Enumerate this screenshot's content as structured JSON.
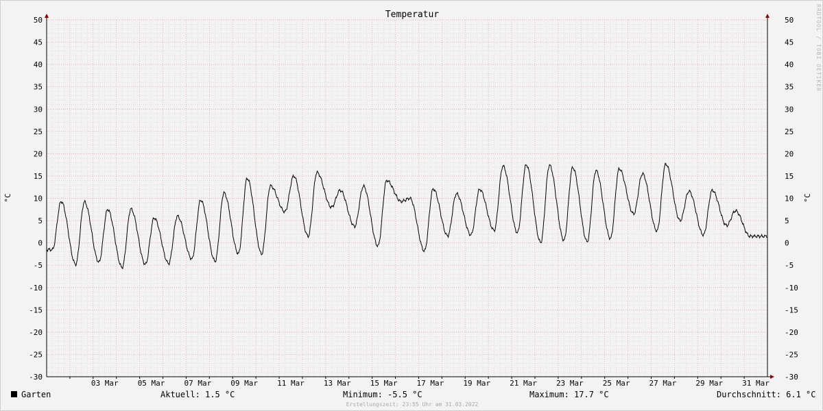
{
  "chart_data": {
    "type": "line",
    "title": "Temperatur",
    "ylabel": "°C",
    "ylim": [
      -30,
      50
    ],
    "y_ticks": [
      50,
      45,
      40,
      35,
      30,
      25,
      20,
      15,
      10,
      5,
      0,
      -5,
      -10,
      -15,
      -20,
      -25,
      -30
    ],
    "x_range": [
      "2022-03-01T00:00",
      "2022-04-01T00:00"
    ],
    "x_ticks": [
      "03 Mar",
      "05 Mar",
      "07 Mar",
      "09 Mar",
      "11 Mar",
      "13 Mar",
      "15 Mar",
      "17 Mar",
      "19 Mar",
      "21 Mar",
      "23 Mar",
      "25 Mar",
      "27 Mar",
      "29 Mar",
      "31 Mar"
    ],
    "grid": true,
    "series": [
      {
        "name": "Garten",
        "color": "#000000",
        "daily": [
          {
            "date": "2022-03-01",
            "min": -1.5,
            "max": 9.3
          },
          {
            "date": "2022-03-02",
            "min": -4.8,
            "max": 9.2
          },
          {
            "date": "2022-03-03",
            "min": -4.3,
            "max": 7.5
          },
          {
            "date": "2022-03-04",
            "min": -5.5,
            "max": 7.6
          },
          {
            "date": "2022-03-05",
            "min": -4.8,
            "max": 5.6
          },
          {
            "date": "2022-03-06",
            "min": -4.6,
            "max": 6.0
          },
          {
            "date": "2022-03-07",
            "min": -3.6,
            "max": 9.6
          },
          {
            "date": "2022-03-08",
            "min": -4.1,
            "max": 11.2
          },
          {
            "date": "2022-03-09",
            "min": -2.4,
            "max": 14.5
          },
          {
            "date": "2022-03-10",
            "min": -2.5,
            "max": 12.8
          },
          {
            "date": "2022-03-11",
            "min": 7.0,
            "max": 15.0
          },
          {
            "date": "2022-03-12",
            "min": 1.5,
            "max": 15.8
          },
          {
            "date": "2022-03-13",
            "min": 8.0,
            "max": 11.8
          },
          {
            "date": "2022-03-14",
            "min": 3.7,
            "max": 12.7
          },
          {
            "date": "2022-03-15",
            "min": -0.7,
            "max": 14.0
          },
          {
            "date": "2022-03-16",
            "min": 9.3,
            "max": 10.0
          },
          {
            "date": "2022-03-17",
            "min": -1.8,
            "max": 12.1
          },
          {
            "date": "2022-03-18",
            "min": 1.6,
            "max": 11.0
          },
          {
            "date": "2022-03-19",
            "min": 1.8,
            "max": 12.0
          },
          {
            "date": "2022-03-20",
            "min": 2.8,
            "max": 17.2
          },
          {
            "date": "2022-03-21",
            "min": 2.3,
            "max": 17.5
          },
          {
            "date": "2022-03-22",
            "min": 0.1,
            "max": 17.4
          },
          {
            "date": "2022-03-23",
            "min": 0.6,
            "max": 16.9
          },
          {
            "date": "2022-03-24",
            "min": 0.3,
            "max": 16.2
          },
          {
            "date": "2022-03-25",
            "min": 1.0,
            "max": 16.6
          },
          {
            "date": "2022-03-26",
            "min": 6.5,
            "max": 15.5
          },
          {
            "date": "2022-03-27",
            "min": 2.7,
            "max": 17.7
          },
          {
            "date": "2022-03-28",
            "min": 5.0,
            "max": 11.6
          },
          {
            "date": "2022-03-29",
            "min": 1.8,
            "max": 11.8
          },
          {
            "date": "2022-03-30",
            "min": 3.9,
            "max": 7.2
          },
          {
            "date": "2022-03-31",
            "min": 1.5,
            "max": 1.5
          }
        ]
      }
    ]
  },
  "legend": {
    "series_label": "Garten",
    "current": "Aktuell: 1.5 °C",
    "minimum": "Minimum: -5.5 °C",
    "maximum": "Maximum: 17.7 °C",
    "average": "Durchschnitt: 6.1 °C"
  },
  "watermark": "RRDTOOL / TOBI OETIKER",
  "footer": "Erstellungszeit: 23:55 Uhr am 31.03.2022"
}
